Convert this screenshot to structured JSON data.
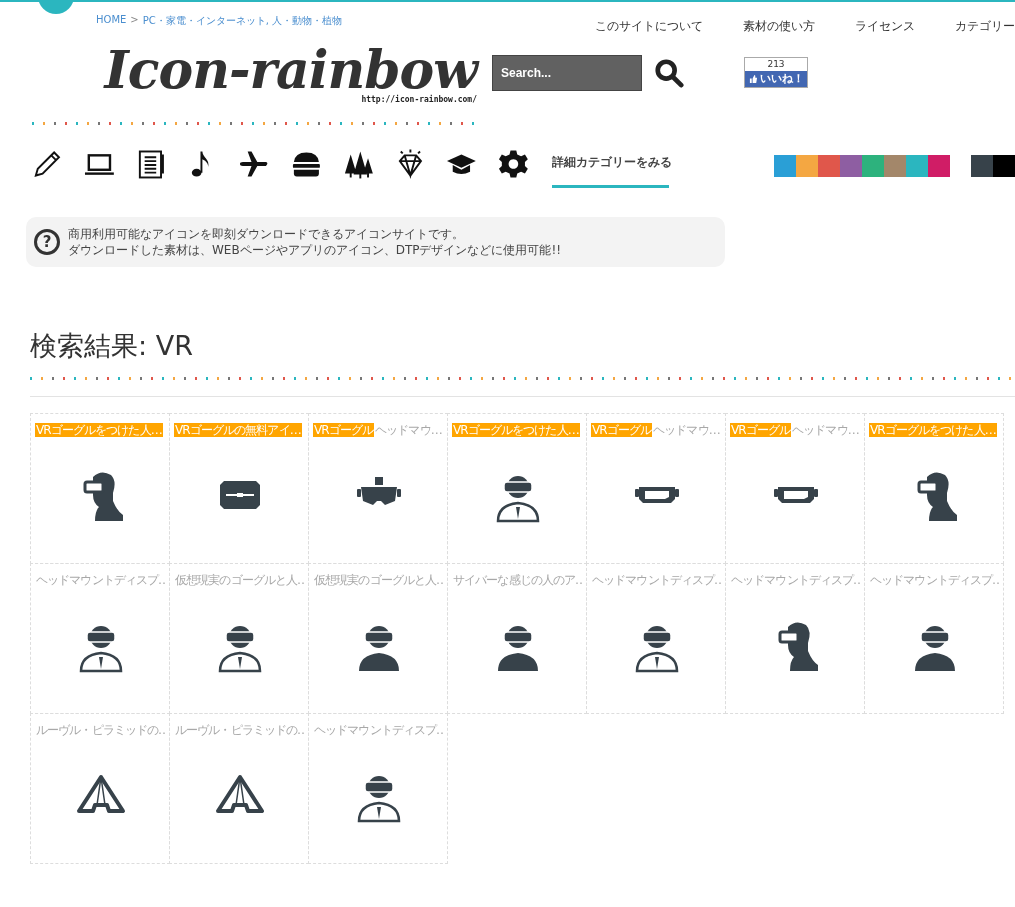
{
  "breadcrumb": {
    "home": "HOME",
    "separator": ">",
    "path": "PC・家電・インターネット, 人・動物・植物"
  },
  "nav": [
    "このサイトについて",
    "素材の使い方",
    "ライセンス",
    "カテゴリー"
  ],
  "logo": {
    "title": "Icon-rainbow",
    "url": "http://icon-rainbow.com/"
  },
  "search": {
    "placeholder": "Search..."
  },
  "like": {
    "count": "213",
    "label": "いいね！"
  },
  "categories": [
    {
      "kind": "pencil"
    },
    {
      "kind": "laptop"
    },
    {
      "kind": "notebook"
    },
    {
      "kind": "note"
    },
    {
      "kind": "airplane"
    },
    {
      "kind": "burger"
    },
    {
      "kind": "trees"
    },
    {
      "kind": "diamond"
    },
    {
      "kind": "cap"
    },
    {
      "kind": "gear"
    }
  ],
  "category_link": "詳細カテゴリーをみる",
  "swatches": [
    {
      "color": "#2a9fd6"
    },
    {
      "color": "#f4a742"
    },
    {
      "color": "#e0574b"
    },
    {
      "color": "#8e5ea2"
    },
    {
      "color": "#2db27d"
    },
    {
      "color": "#a3876a"
    },
    {
      "color": "#2bb6bf"
    },
    {
      "color": "#d01d66"
    }
  ],
  "swatches_2": [
    {
      "color": "#37424a"
    },
    {
      "color": "#000000"
    }
  ],
  "info": {
    "icon": "?",
    "lines": [
      "商用利用可能なアイコンを即刻ダウンロードできるアイコンサイトです。",
      "ダウンロードした素材は、WEBページやアプリのアイコン、DTPデザインなどに使用可能!!"
    ]
  },
  "heading": "検索結果: VR",
  "results": [
    {
      "highlight": "VRゴーグルをつけた人…",
      "kind": "profile"
    },
    {
      "highlight": "VRゴーグルの無料アイ…",
      "kind": "box"
    },
    {
      "highlight": "VRゴーグル",
      "rest": "ヘッドマウ…",
      "kind": "headset"
    },
    {
      "highlight": "VRゴーグルをつけた人…",
      "kind": "person-outline"
    },
    {
      "highlight": "VRゴーグル",
      "rest": "ヘッドマウ…",
      "kind": "goggles"
    },
    {
      "highlight": "VRゴーグル",
      "rest": "ヘッドマウ…",
      "kind": "goggles"
    },
    {
      "highlight": "VRゴーグルをつけた人…",
      "kind": "profile"
    },
    {
      "rest": "ヘッドマウントディスプ…",
      "kind": "person-outline"
    },
    {
      "rest": "仮想現実のゴーグルと人…",
      "kind": "person-outline"
    },
    {
      "rest": "仮想現実のゴーグルと人…",
      "kind": "person-solid"
    },
    {
      "rest": "サイバーな感じの人のア…",
      "kind": "person-solid"
    },
    {
      "rest": "ヘッドマウントディスプ…",
      "kind": "person-outline"
    },
    {
      "rest": "ヘッドマウントディスプ…",
      "kind": "profile"
    },
    {
      "rest": "ヘッドマウントディスプ…",
      "kind": "person-solid"
    },
    {
      "rest": "ルーヴル・ピラミッドの…",
      "kind": "pyramid"
    },
    {
      "rest": "ルーヴル・ピラミッドの…",
      "kind": "pyramid"
    },
    {
      "rest": "ヘッドマウントディスプ…",
      "kind": "person-outline"
    }
  ]
}
